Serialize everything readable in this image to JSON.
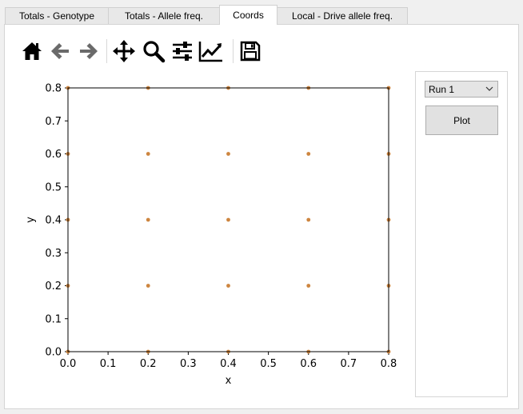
{
  "tabs": [
    {
      "label": "Totals - Genotype"
    },
    {
      "label": "Totals - Allele freq."
    },
    {
      "label": "Coords"
    },
    {
      "label": "Local - Drive allele freq."
    }
  ],
  "active_tab": 2,
  "toolbar": {
    "icons": [
      "home-icon",
      "back-arrow-icon",
      "forward-arrow-icon",
      "pan-icon",
      "zoom-icon",
      "subplots-config-icon",
      "edit-axes-icon",
      "save-icon"
    ]
  },
  "controls": {
    "run_select": "Run 1",
    "plot_button": "Plot"
  },
  "colors": {
    "point": "#cd853f"
  },
  "chart_data": {
    "type": "scatter",
    "title": "",
    "xlabel": "x",
    "ylabel": "y",
    "xlim": [
      0.0,
      0.8
    ],
    "ylim": [
      0.0,
      0.8
    ],
    "xticks": [
      "0.0",
      "0.1",
      "0.2",
      "0.3",
      "0.4",
      "0.5",
      "0.6",
      "0.7",
      "0.8"
    ],
    "yticks": [
      "0.0",
      "0.1",
      "0.2",
      "0.3",
      "0.4",
      "0.5",
      "0.6",
      "0.7",
      "0.8"
    ],
    "grid": false,
    "points": [
      [
        0.0,
        0.0
      ],
      [
        0.2,
        0.0
      ],
      [
        0.4,
        0.0
      ],
      [
        0.6,
        0.0
      ],
      [
        0.8,
        0.0
      ],
      [
        0.0,
        0.2
      ],
      [
        0.2,
        0.2
      ],
      [
        0.4,
        0.2
      ],
      [
        0.6,
        0.2
      ],
      [
        0.8,
        0.2
      ],
      [
        0.0,
        0.4
      ],
      [
        0.2,
        0.4
      ],
      [
        0.4,
        0.4
      ],
      [
        0.6,
        0.4
      ],
      [
        0.8,
        0.4
      ],
      [
        0.0,
        0.6
      ],
      [
        0.2,
        0.6
      ],
      [
        0.4,
        0.6
      ],
      [
        0.6,
        0.6
      ],
      [
        0.8,
        0.6
      ],
      [
        0.0,
        0.8
      ],
      [
        0.2,
        0.8
      ],
      [
        0.4,
        0.8
      ],
      [
        0.6,
        0.8
      ],
      [
        0.8,
        0.8
      ]
    ]
  }
}
